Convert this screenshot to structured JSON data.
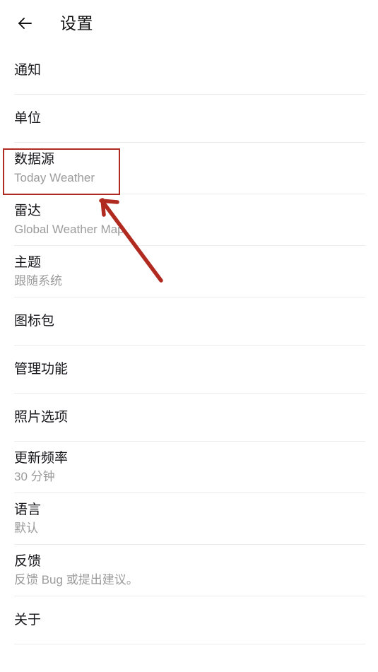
{
  "appbar": {
    "back_icon": "back-arrow-icon",
    "title": "设置"
  },
  "settings": {
    "items": [
      {
        "title": "通知",
        "subtitle": ""
      },
      {
        "title": "单位",
        "subtitle": ""
      },
      {
        "title": "数据源",
        "subtitle": "Today Weather"
      },
      {
        "title": "雷达",
        "subtitle": "Global Weather Map"
      },
      {
        "title": "主题",
        "subtitle": "跟随系统"
      },
      {
        "title": "图标包",
        "subtitle": ""
      },
      {
        "title": "管理功能",
        "subtitle": ""
      },
      {
        "title": "照片选项",
        "subtitle": ""
      },
      {
        "title": "更新频率",
        "subtitle": "30 分钟"
      },
      {
        "title": "语言",
        "subtitle": "默认"
      },
      {
        "title": "反馈",
        "subtitle": "反馈 Bug 或提出建议。"
      },
      {
        "title": "关于",
        "subtitle": ""
      }
    ]
  },
  "annotation": {
    "color": "#b02a20",
    "target_item": "数据源",
    "shapes": [
      "highlight-rectangle",
      "pointer-arrow"
    ]
  }
}
